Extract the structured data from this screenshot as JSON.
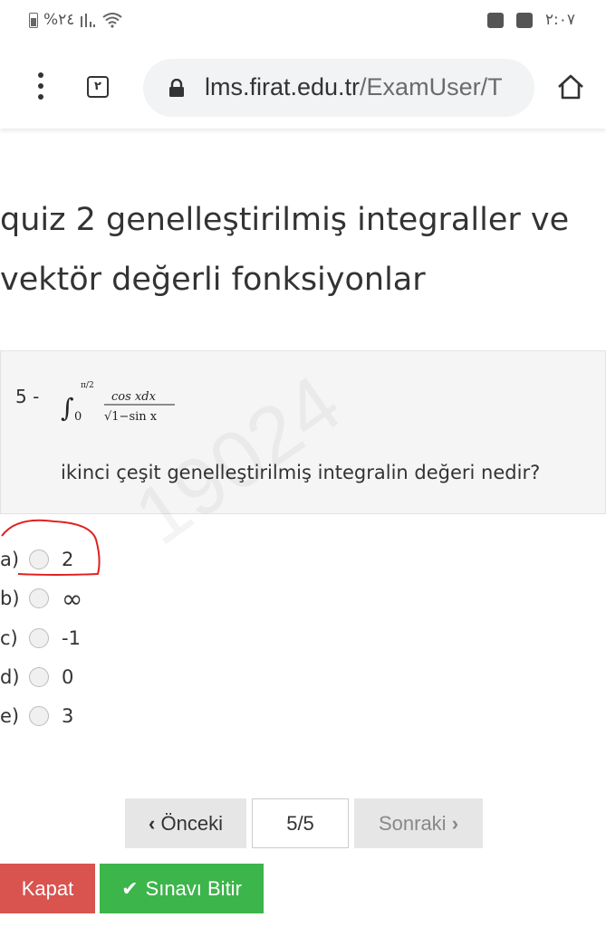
{
  "status_bar": {
    "battery_percent": "%٢٤",
    "time": "٢:٠٧",
    "icons": [
      "battery-icon",
      "signal-icon",
      "wifi-icon",
      "image-icon",
      "clock-icon"
    ]
  },
  "browser": {
    "tab_count": "٢",
    "url_domain": "lms.firat.edu.tr",
    "url_path": "/ExamUser/T",
    "icons": [
      "menu-icon",
      "tabs-icon",
      "lock-icon",
      "home-icon"
    ]
  },
  "quiz": {
    "title": "quiz 2 genelleştirilmiş integraller ve vektör değerli fonksiyonlar",
    "question": {
      "number": "5 -",
      "formula_upper": "π/2",
      "formula_lower": "0",
      "formula_numerator": "cos xdx",
      "formula_denominator": "√1−sin x",
      "text": "ikinci çeşit genelleştirilmiş integralin değeri nedir?"
    },
    "options": [
      {
        "letter": "a)",
        "value": "2"
      },
      {
        "letter": "b)",
        "value": "∞"
      },
      {
        "letter": "c)",
        "value": "-1"
      },
      {
        "letter": "d)",
        "value": "0"
      },
      {
        "letter": "e)",
        "value": "3"
      }
    ],
    "watermark": "19024"
  },
  "navigation": {
    "prev_label": "Önceki",
    "page_indicator": "5/5",
    "next_label": "Sonraki"
  },
  "actions": {
    "close_label": "Kapat",
    "finish_label": "Sınavı Bitir"
  },
  "colors": {
    "close": "#d9534f",
    "finish": "#3cb54a",
    "annotation": "#e02020"
  }
}
